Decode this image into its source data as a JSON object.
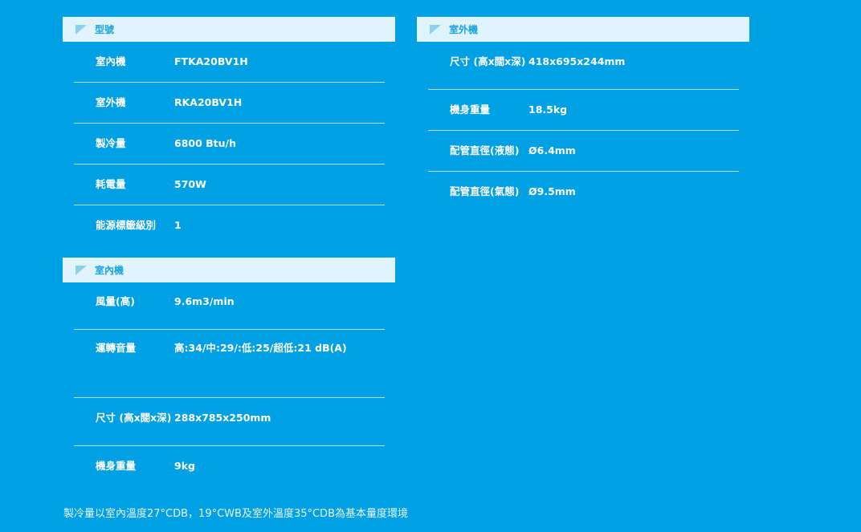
{
  "model_section": {
    "title": "型號",
    "rows": [
      {
        "key": "室內機",
        "value": "FTKA20BV1H"
      },
      {
        "key": "室外機",
        "value": "RKA20BV1H"
      },
      {
        "key": "製冷量",
        "value": "6800 Btu/h"
      },
      {
        "key": "耗電量",
        "value": "570W"
      },
      {
        "key": "能源標籤級別",
        "value": "1"
      }
    ]
  },
  "indoor_section": {
    "title": "室內機",
    "rows": [
      {
        "key": "風量(高)",
        "value": "9.6m3/min"
      },
      {
        "key": "運轉音量",
        "value": "高:34/中:29/:低:25/超低:21 dB(A)"
      },
      {
        "key": "尺寸 (高x闊x深)",
        "value": "288x785x250mm"
      },
      {
        "key": "機身重量",
        "value": "9kg"
      }
    ]
  },
  "outdoor_section": {
    "title": "室外機",
    "rows": [
      {
        "key": "尺寸 (高x闊x深)",
        "value": "418x695x244mm"
      },
      {
        "key": "機身重量",
        "value": "18.5kg"
      },
      {
        "key": "配管直徑(液態)",
        "value": "Ø6.4mm"
      },
      {
        "key": "配管直徑(氣態)",
        "value": "Ø9.5mm"
      }
    ]
  },
  "footnote": "製冷量以室內溫度27°CDB，19°CWB及室外溫度35°CDB為基本量度環境",
  "colors": {
    "background": "#00a0e4",
    "header_bg": "#dff4fd",
    "header_text": "#1aa3dc",
    "icon": "#8ecfee"
  },
  "icons": {
    "section_marker": "triangle-corner-icon"
  }
}
